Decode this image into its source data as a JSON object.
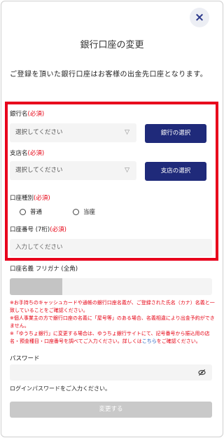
{
  "dialog": {
    "title": "銀行口座の変更",
    "close_label": "×",
    "intro": "ご登録を頂いた銀行口座はお客様の出金先口座となります。"
  },
  "bank": {
    "label": "銀行名",
    "required": "(必須)",
    "placeholder": "選択してください",
    "button": "銀行の選択"
  },
  "branch": {
    "label": "支店名",
    "required": "(必須)",
    "placeholder": "選択してください",
    "button": "支店の選択"
  },
  "account_type": {
    "label": "口座種別",
    "required": "(必須)",
    "options": [
      "普通",
      "当座"
    ]
  },
  "account_number": {
    "label": "口座番号 (7桁)",
    "required": "(必須)",
    "placeholder": "入力してください"
  },
  "account_name": {
    "label": "口座名義 フリガナ (全角)"
  },
  "notes": {
    "line1": "※お手持ちのキャッシュカードや通帳の銀行口座名義が、ご登録された氏名（カナ）名義と一致していることをご確認ください。",
    "line2": "※個人事業主の方で銀行口座の名義に「屋号等」のある場合、名義相違により出金予約ができません。",
    "line3": "※「ゆうちょ銀行」に変更する場合は、ゆうちょ銀行サイトにて、記号番号から振込用の店名・預金種目・口座番号を調べてご入力ください。詳しくは",
    "link": "こちら",
    "line3_end": "をご確認ください。"
  },
  "password": {
    "label": "パスワード",
    "hint": "ログインパスワードをご入力ください。"
  },
  "submit": {
    "label": "変更する"
  },
  "colors": {
    "accent": "#1f2a7a",
    "required": "#e60012",
    "highlight_border": "#e8001c"
  },
  "icons": {
    "close": "close-icon",
    "dropdown": "chevron-down-icon",
    "password_toggle": "eye-slash-icon"
  }
}
